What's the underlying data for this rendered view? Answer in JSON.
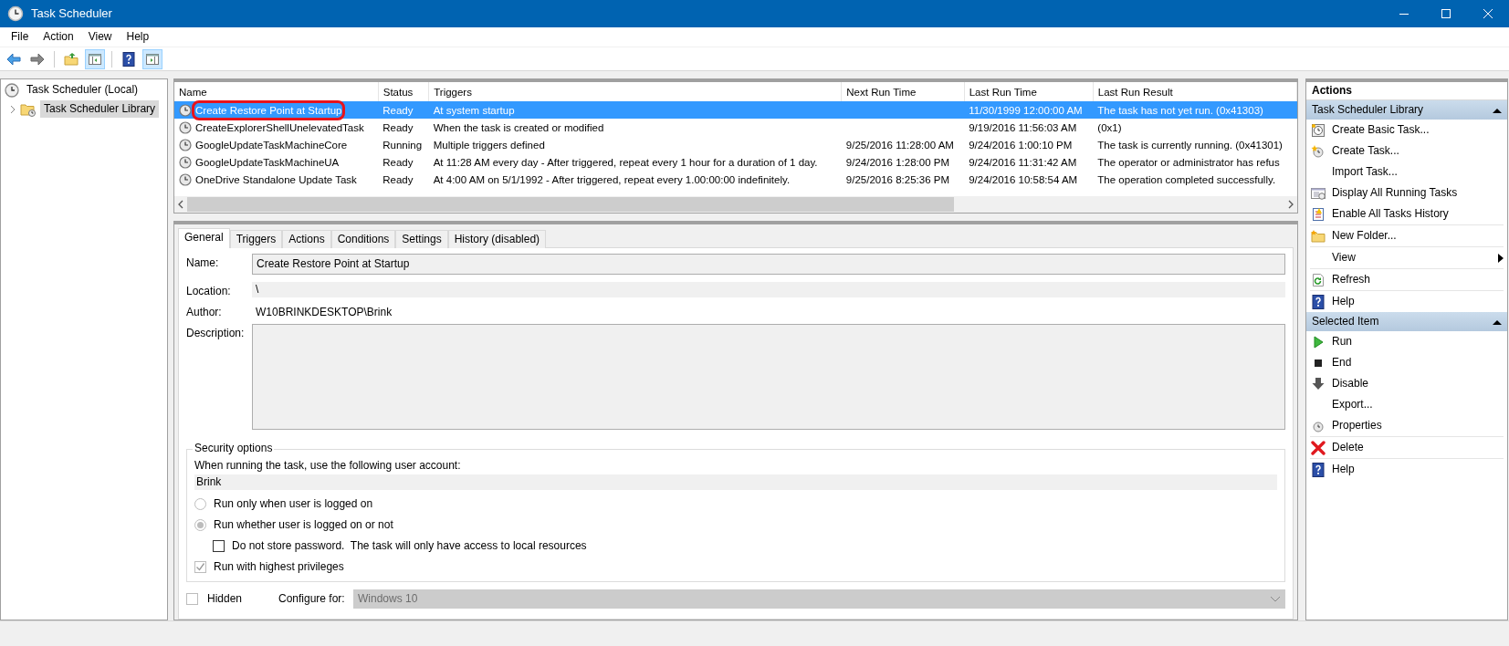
{
  "window": {
    "title": "Task Scheduler"
  },
  "menu": [
    "File",
    "Action",
    "View",
    "Help"
  ],
  "toolbar": [
    {
      "pressed": false
    },
    {
      "pressed": false
    },
    {
      "pressed": false
    },
    {
      "pressed": true
    },
    {
      "pressed": false
    },
    {
      "pressed": true
    }
  ],
  "tree": [
    {
      "label": "Task Scheduler (Local)",
      "selected": false,
      "children": [
        {
          "label": "Task Scheduler Library",
          "selected": true,
          "expanded": false
        }
      ]
    }
  ],
  "tasks": {
    "columns": [
      "Name",
      "Status",
      "Triggers",
      "Next Run Time",
      "Last Run Time",
      "Last Run Result"
    ],
    "rows": [
      {
        "selected": true,
        "highlighted": true,
        "cells": [
          "Create Restore Point at Startup",
          "Ready",
          "At system startup",
          "",
          "11/30/1999 12:00:00 AM",
          "The task has not yet run. (0x41303)"
        ]
      },
      {
        "selected": false,
        "highlighted": false,
        "cells": [
          "CreateExplorerShellUnelevatedTask",
          "Ready",
          "When the task is created or modified",
          "",
          "9/19/2016 11:56:03 AM",
          "(0x1)"
        ]
      },
      {
        "selected": false,
        "highlighted": false,
        "cells": [
          "GoogleUpdateTaskMachineCore",
          "Running",
          "Multiple triggers defined",
          "9/25/2016 11:28:00 AM",
          "9/24/2016 1:00:10 PM",
          "The task is currently running. (0x41301)"
        ]
      },
      {
        "selected": false,
        "highlighted": false,
        "cells": [
          "GoogleUpdateTaskMachineUA",
          "Ready",
          "At 11:28 AM every day - After triggered, repeat every 1 hour for a duration of 1 day.",
          "9/24/2016 1:28:00 PM",
          "9/24/2016 11:31:42 AM",
          "The operator or administrator has refus"
        ]
      },
      {
        "selected": false,
        "highlighted": false,
        "cells": [
          "OneDrive Standalone Update Task",
          "Ready",
          "At 4:00 AM on 5/1/1992 - After triggered, repeat every 1.00:00:00 indefinitely.",
          "9/25/2016 8:25:36 PM",
          "9/24/2016 10:58:54 AM",
          "The operation completed successfully."
        ]
      }
    ]
  },
  "tabs": [
    {
      "label": "General",
      "selected": true
    },
    {
      "label": "Triggers",
      "selected": false
    },
    {
      "label": "Actions",
      "selected": false
    },
    {
      "label": "Conditions",
      "selected": false
    },
    {
      "label": "Settings",
      "selected": false
    },
    {
      "label": "History (disabled)",
      "selected": false
    }
  ],
  "general": {
    "fields": [
      {
        "kind": "input",
        "label": "Name:",
        "value": "Create Restore Point at Startup"
      },
      {
        "kind": "readonly",
        "label": "Location:",
        "value": "\\"
      },
      {
        "kind": "text",
        "label": "Author:",
        "value": "W10BRINKDESKTOP\\Brink"
      },
      {
        "kind": "textarea",
        "label": "Description:"
      }
    ],
    "security": {
      "title": "Security options",
      "account_label": "When running the task, use the following user account:",
      "account": "Brink",
      "options": [
        {
          "kind": "radio",
          "label": "Run only when user is logged on",
          "selected": false,
          "disabled": true
        },
        {
          "kind": "radio",
          "label": "Run whether user is logged on or not",
          "selected": true,
          "disabled": true,
          "children": [
            {
              "kind": "checkbox",
              "label": "Do not store password.  The task will only have access to local resources",
              "checked": false,
              "disabled": false
            }
          ]
        },
        {
          "kind": "checkbox",
          "label": "Run with highest privileges",
          "checked": true,
          "disabled": true
        }
      ]
    },
    "hidden": {
      "label": "Hidden",
      "checked": false
    },
    "configure": {
      "label": "Configure for:",
      "value": "Windows 10",
      "disabled": true
    }
  },
  "actions": {
    "title": "Actions",
    "sections": [
      {
        "title": "Task Scheduler Library",
        "expanded": true,
        "groups": [
          [
            {
              "label": "Create Basic Task..."
            },
            {
              "label": "Create Task..."
            },
            {
              "label": "Import Task..."
            },
            {
              "label": "Display All Running Tasks"
            },
            {
              "label": "Enable All Tasks History"
            }
          ],
          [
            {
              "label": "New Folder..."
            }
          ],
          [
            {
              "label": "View",
              "submenu": true
            }
          ],
          [
            {
              "label": "Refresh"
            }
          ],
          [
            {
              "label": "Help"
            }
          ]
        ]
      },
      {
        "title": "Selected Item",
        "expanded": true,
        "groups": [
          [
            {
              "label": "Run"
            },
            {
              "label": "End"
            },
            {
              "label": "Disable"
            },
            {
              "label": "Export..."
            },
            {
              "label": "Properties"
            }
          ],
          [
            {
              "label": "Delete"
            }
          ],
          [
            {
              "label": "Help"
            }
          ]
        ]
      }
    ]
  }
}
